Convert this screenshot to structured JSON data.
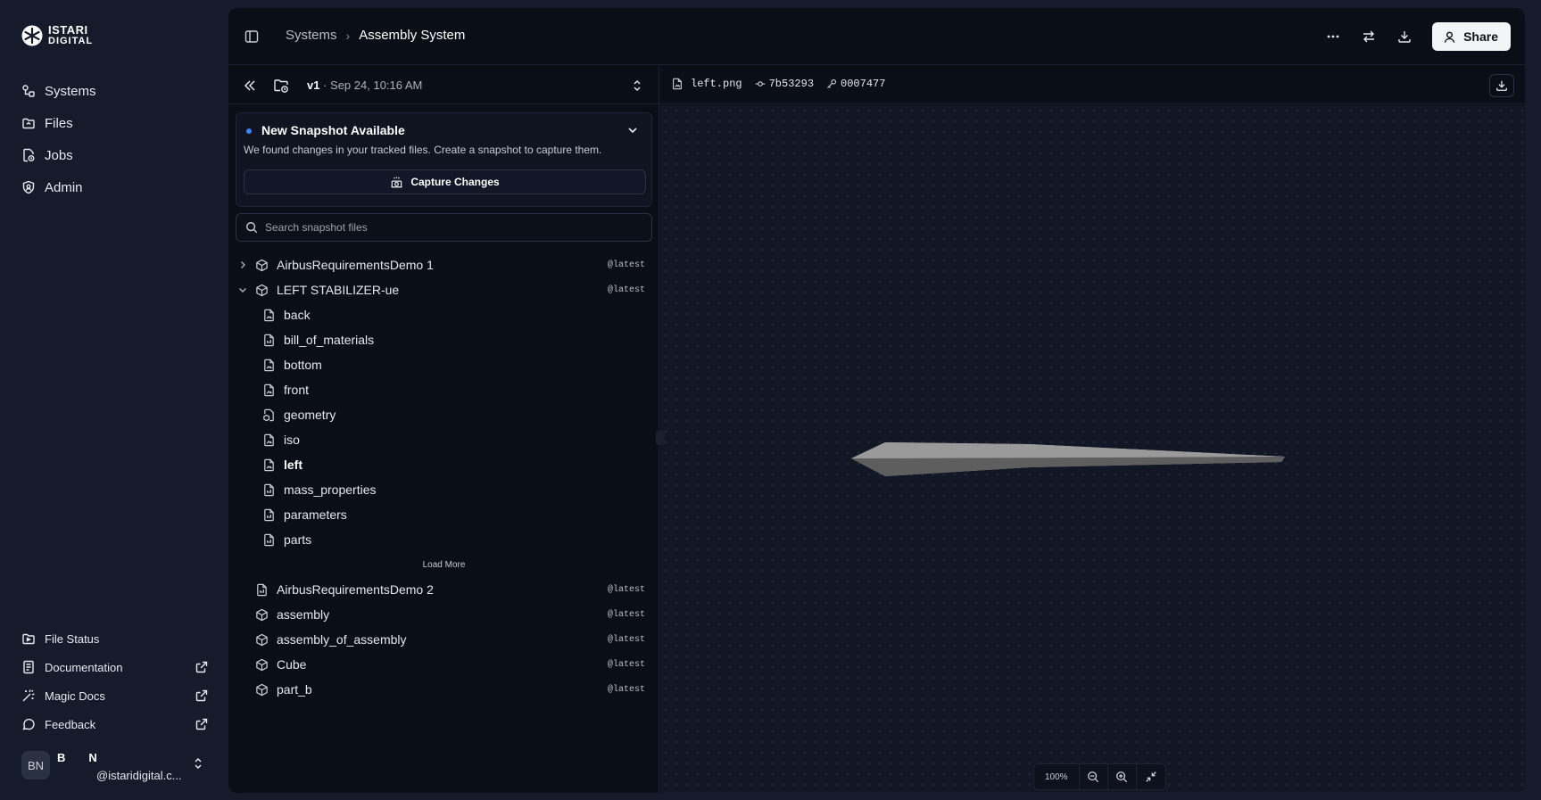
{
  "brand": {
    "line1": "ISTARI",
    "line2": "DIGITAL"
  },
  "nav": {
    "items": [
      {
        "label": "Systems",
        "icon": "systems-icon"
      },
      {
        "label": "Files",
        "icon": "files-icon"
      },
      {
        "label": "Jobs",
        "icon": "jobs-icon"
      },
      {
        "label": "Admin",
        "icon": "admin-icon"
      }
    ],
    "bottom": [
      {
        "label": "File Status"
      },
      {
        "label": "Documentation"
      },
      {
        "label": "Magic Docs"
      },
      {
        "label": "Feedback"
      }
    ]
  },
  "user": {
    "avatar": "BN",
    "first_initial": "B",
    "last_initial": "N",
    "email": "@istaridigital.c..."
  },
  "breadcrumb": {
    "parent": "Systems",
    "separator": "›",
    "current": "Assembly System"
  },
  "toolbar": {
    "share_label": "Share"
  },
  "snapshot": {
    "version": "v1",
    "date": "· Sep 24, 10:16 AM"
  },
  "notice": {
    "title": "New Snapshot Available",
    "description": "We found changes in your tracked files. Create a snapshot to capture them.",
    "button": "Capture Changes"
  },
  "search": {
    "placeholder": "Search snapshot files"
  },
  "tree": {
    "groups_top": [
      {
        "label": "AirbusRequirementsDemo 1",
        "tag": "@latest",
        "expanded": false
      },
      {
        "label": "LEFT STABILIZER-ue",
        "tag": "@latest",
        "expanded": true
      }
    ],
    "children": [
      {
        "label": "back"
      },
      {
        "label": "bill_of_materials"
      },
      {
        "label": "bottom"
      },
      {
        "label": "front"
      },
      {
        "label": "geometry"
      },
      {
        "label": "iso"
      },
      {
        "label": "left"
      },
      {
        "label": "mass_properties"
      },
      {
        "label": "parameters"
      },
      {
        "label": "parts"
      }
    ],
    "load_more": "Load More",
    "groups_bottom": [
      {
        "label": "AirbusRequirementsDemo 2",
        "tag": "@latest"
      },
      {
        "label": "assembly",
        "tag": "@latest"
      },
      {
        "label": "assembly_of_assembly",
        "tag": "@latest"
      },
      {
        "label": "Cube",
        "tag": "@latest"
      },
      {
        "label": "part_b",
        "tag": "@latest"
      }
    ]
  },
  "preview": {
    "filename": "left.png",
    "commit": "7b53293",
    "key": "0007477",
    "zoom": "100%"
  }
}
